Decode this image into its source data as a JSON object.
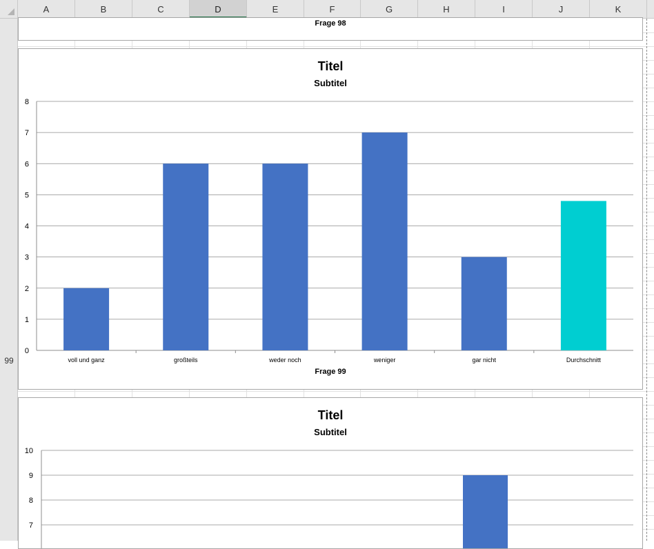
{
  "sheet": {
    "columns": [
      {
        "letter": "A",
        "active": false
      },
      {
        "letter": "B",
        "active": false
      },
      {
        "letter": "C",
        "active": false
      },
      {
        "letter": "D",
        "active": true
      },
      {
        "letter": "E",
        "active": false
      },
      {
        "letter": "F",
        "active": false
      },
      {
        "letter": "G",
        "active": false
      },
      {
        "letter": "H",
        "active": false
      },
      {
        "letter": "I",
        "active": false
      },
      {
        "letter": "J",
        "active": false
      },
      {
        "letter": "K",
        "active": false
      }
    ],
    "rows": [
      {
        "label": "99"
      }
    ]
  },
  "charts": {
    "top": {
      "xtitle": "Frage 98"
    },
    "main": {
      "title": "Titel",
      "subtitle": "Subtitel",
      "xtitle": "Frage 99"
    },
    "bottom": {
      "title": "Titel",
      "subtitle": "Subtitel"
    }
  },
  "chart_data": [
    {
      "type": "bar",
      "title": "Titel",
      "subtitle": "Subtitel",
      "xlabel": "Frage 99",
      "ylabel": "",
      "categories": [
        "voll und ganz",
        "großteils",
        "weder noch",
        "weniger",
        "gar nicht",
        "Durchschnitt"
      ],
      "values": [
        2,
        6,
        6,
        7,
        3,
        4.8
      ],
      "colors": [
        "#4472C4",
        "#4472C4",
        "#4472C4",
        "#4472C4",
        "#4472C4",
        "#00CED1"
      ],
      "ylim": [
        0,
        8
      ],
      "yticks": [
        0,
        1,
        2,
        3,
        4,
        5,
        6,
        7,
        8
      ],
      "grid": true
    },
    {
      "type": "bar",
      "title": "Titel",
      "subtitle": "Subtitel",
      "xlabel": "",
      "ylabel": "",
      "categories": [],
      "values": [
        9
      ],
      "colors": [
        "#4472C4"
      ],
      "ylim": [
        0,
        10
      ],
      "yticks_visible": [
        7,
        8,
        9,
        10
      ],
      "grid": true
    }
  ]
}
